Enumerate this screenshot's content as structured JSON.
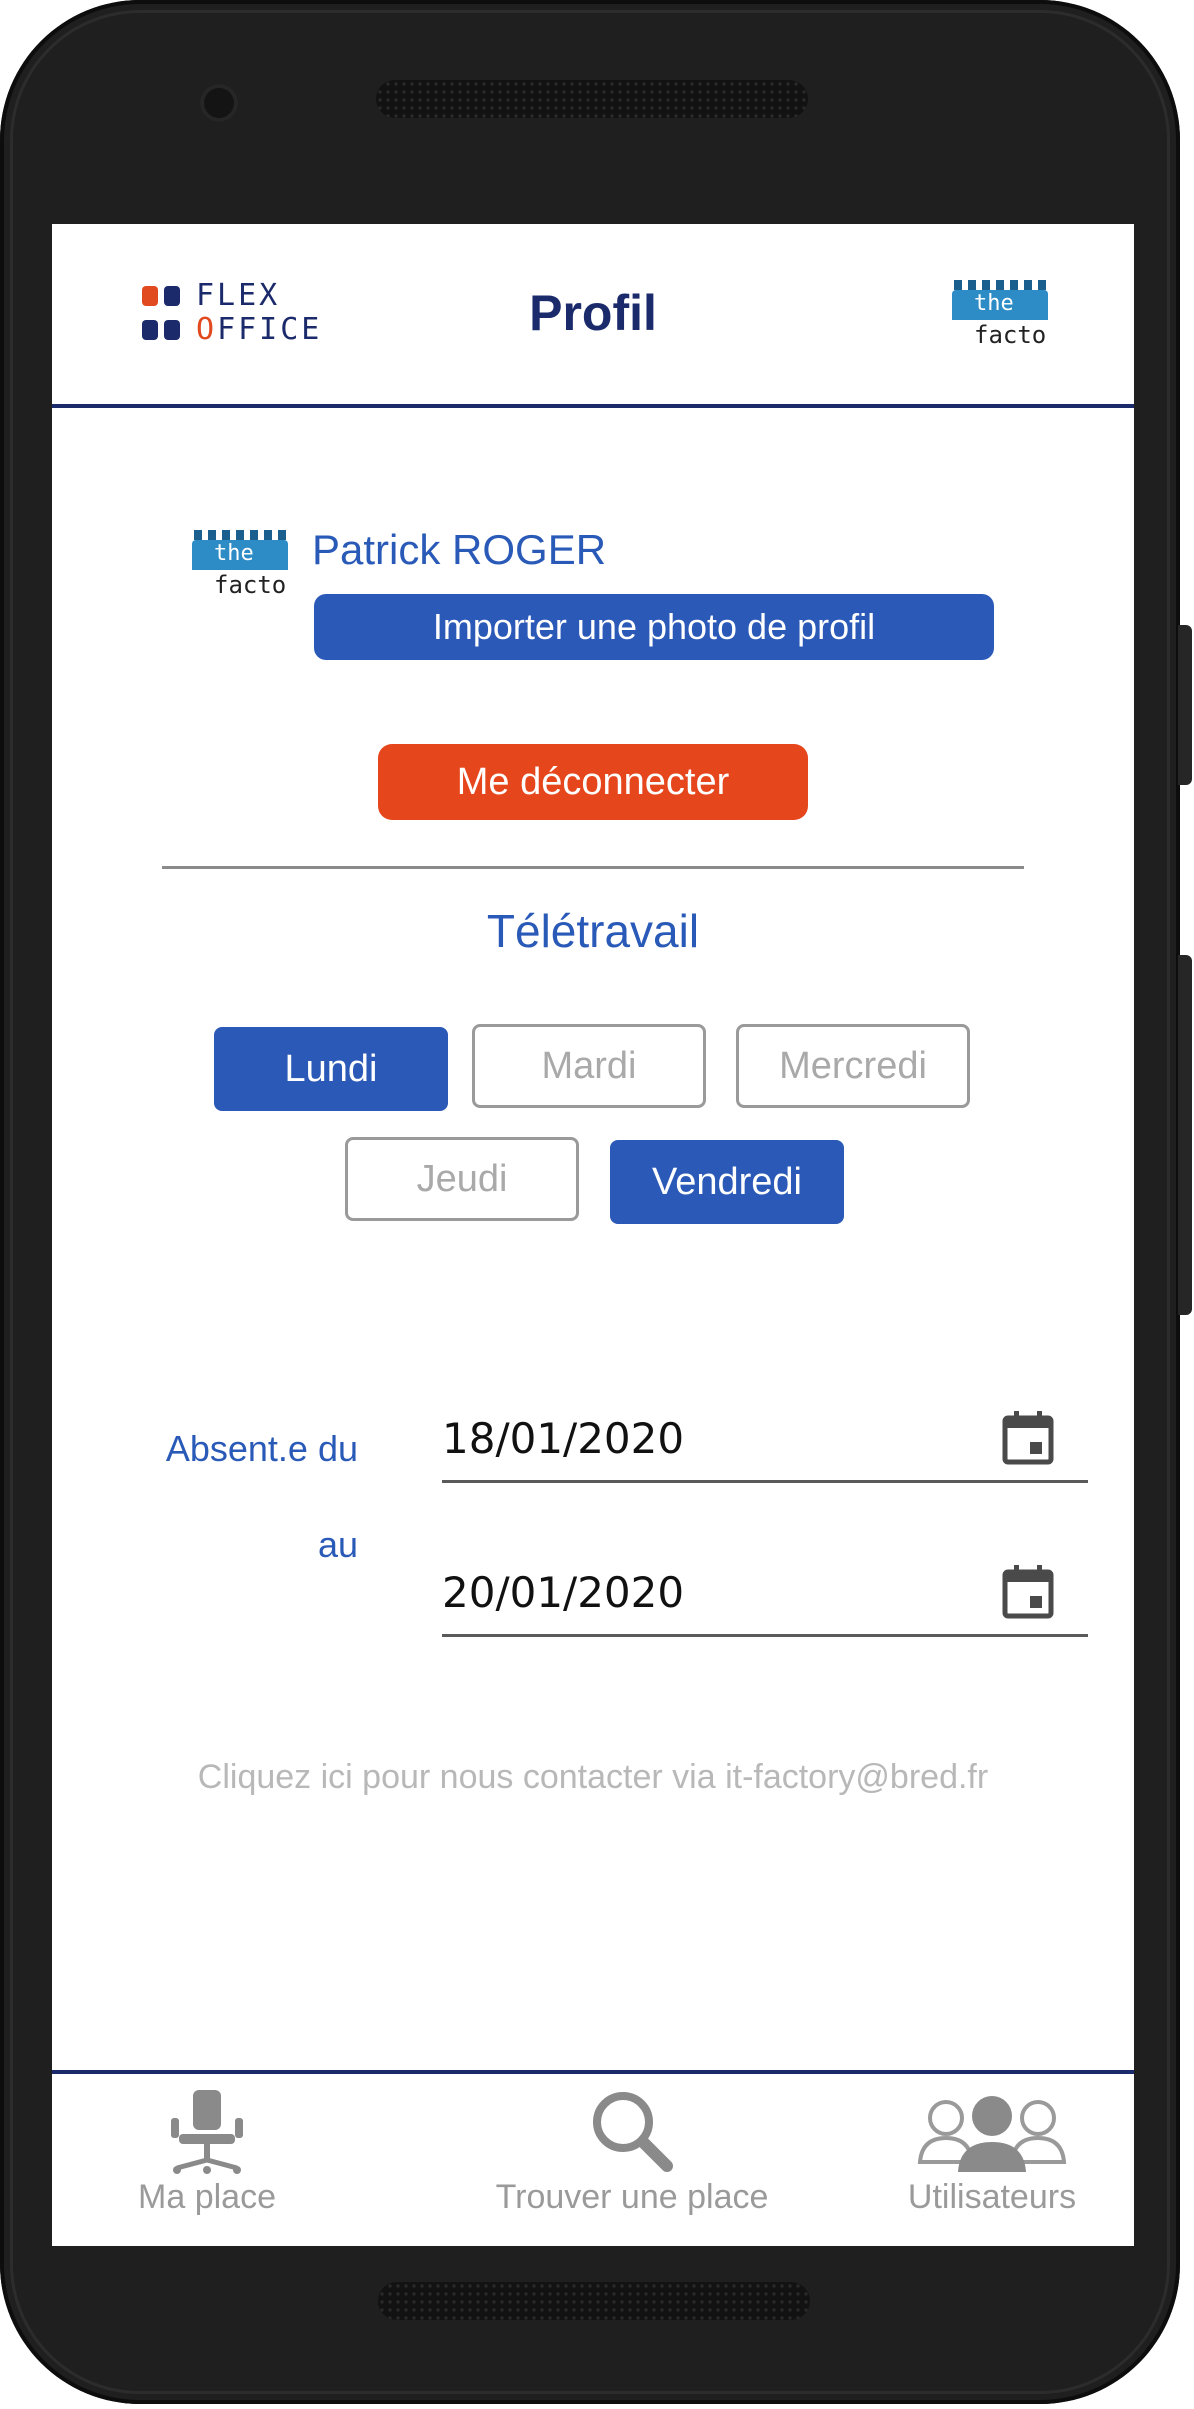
{
  "header": {
    "logo_line1": "FLEX",
    "logo_line2_first": "O",
    "logo_line2_rest": "FFICE",
    "title": "Profil",
    "factory_logo_top": "the",
    "factory_logo_bottom": "facto"
  },
  "profile": {
    "user_name": "Patrick ROGER",
    "import_photo_label": "Importer une photo de profil",
    "logout_label": "Me déconnecter"
  },
  "telework": {
    "title": "Télétravail",
    "days": [
      {
        "label": "Lundi",
        "selected": true
      },
      {
        "label": "Mardi",
        "selected": false
      },
      {
        "label": "Mercredi",
        "selected": false
      },
      {
        "label": "Jeudi",
        "selected": false
      },
      {
        "label": "Vendredi",
        "selected": true
      }
    ]
  },
  "absence": {
    "from_label": "Absent.e du",
    "to_label": "au",
    "from_date": "18/01/2020",
    "to_date": "20/01/2020"
  },
  "contact_text": "Cliquez ici pour nous contacter via it-factory@bred.fr",
  "nav": {
    "items": [
      {
        "label": "Ma place",
        "icon": "office-chair-icon"
      },
      {
        "label": "Trouver une place",
        "icon": "search-icon"
      },
      {
        "label": "Utilisateurs",
        "icon": "users-icon"
      }
    ]
  },
  "colors": {
    "primary": "#2b59b8",
    "navy": "#1b2a6b",
    "danger": "#e6461c",
    "muted": "#9a9a9a"
  }
}
